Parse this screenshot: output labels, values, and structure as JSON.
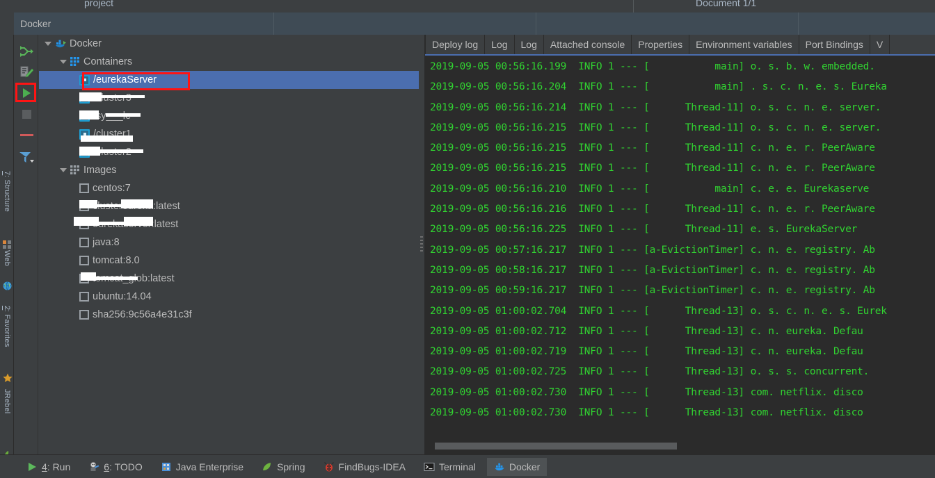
{
  "top_strip": {
    "project_tab": "project",
    "document_tab": "Document 1/1"
  },
  "tool_window": {
    "title": "Docker"
  },
  "left_vertical_bar": {
    "items": [
      {
        "num": "7",
        "label": ": Structure",
        "icon": "structure-icon"
      },
      {
        "num": "",
        "label": "Web",
        "icon": "web-globe-icon"
      },
      {
        "num": "2",
        "label": ": Favorites",
        "icon": "star-icon"
      },
      {
        "num": "",
        "label": "JRebel",
        "icon": "jrebel-icon"
      }
    ]
  },
  "docker_toolbar": {
    "buttons": [
      {
        "name": "connect-deploy-icon",
        "tooltip": "Deploy"
      },
      {
        "name": "edit-deployment-icon",
        "tooltip": "Edit Deployment"
      },
      {
        "name": "run-icon",
        "tooltip": "Run",
        "highlighted": true
      },
      {
        "name": "stop-icon",
        "tooltip": "Stop"
      },
      {
        "name": "remove-icon",
        "tooltip": "Remove"
      },
      {
        "name": "filter-icon",
        "tooltip": "Filter"
      }
    ]
  },
  "tree": {
    "root": {
      "label": "Docker",
      "icon": "docker-whale-icon",
      "expanded": true
    },
    "containers_node": {
      "label": "Containers",
      "icon": "grid-icon",
      "expanded": true
    },
    "containers": [
      {
        "label": "/eurekaServer",
        "selected": true,
        "redacted": false
      },
      {
        "label": "/cluster3",
        "selected": false,
        "redacted": true
      },
      {
        "label": "/sy___le",
        "selected": false,
        "redacted": true
      },
      {
        "label": "/cluster1",
        "selected": false,
        "redacted": true
      },
      {
        "label": "/cluster2",
        "selected": false,
        "redacted": true
      }
    ],
    "images_node": {
      "label": "Images",
      "icon": "grid-icon",
      "expanded": true
    },
    "images": [
      {
        "label": "centos:7",
        "redacted": false
      },
      {
        "label": "clustereureka:latest",
        "redacted": true
      },
      {
        "label": "eurekaserver:latest",
        "redacted": true
      },
      {
        "label": "java:8",
        "redacted": false
      },
      {
        "label": "tomcat:8.0",
        "redacted": false
      },
      {
        "label": "tomcat_glob:latest",
        "redacted": true
      },
      {
        "label": "ubuntu:14.04",
        "redacted": false
      },
      {
        "label": "sha256:9c56a4e31c3f",
        "redacted": false
      }
    ]
  },
  "log_panel": {
    "tabs": [
      {
        "label": "Deploy log",
        "active": false
      },
      {
        "label": "Log",
        "active": false
      },
      {
        "label": "Log",
        "active": false
      },
      {
        "label": "Attached console",
        "active": false
      },
      {
        "label": "Properties",
        "active": false
      },
      {
        "label": "Environment variables",
        "active": false
      },
      {
        "label": "Port Bindings",
        "active": false
      },
      {
        "label": "V",
        "active": false
      }
    ],
    "lines": [
      "2019-09-05 00:56:16.199  INFO 1 --- [           main] o. s. b. w. embedded.",
      "2019-09-05 00:56:16.204  INFO 1 --- [           main] . s. c. n. e. s. Eureka",
      "2019-09-05 00:56:16.214  INFO 1 --- [      Thread-11] o. s. c. n. e. server.",
      "2019-09-05 00:56:16.215  INFO 1 --- [      Thread-11] o. s. c. n. e. server.",
      "2019-09-05 00:56:16.215  INFO 1 --- [      Thread-11] c. n. e. r. PeerAware",
      "2019-09-05 00:56:16.215  INFO 1 --- [      Thread-11] c. n. e. r. PeerAware",
      "2019-09-05 00:56:16.210  INFO 1 --- [           main] c. e. e. Eurekaserve",
      "2019-09-05 00:56:16.216  INFO 1 --- [      Thread-11] c. n. e. r. PeerAware",
      "2019-09-05 00:56:16.225  INFO 1 --- [      Thread-11] e. s. EurekaServer",
      "2019-09-05 00:57:16.217  INFO 1 --- [a-EvictionTimer] c. n. e. registry. Ab",
      "2019-09-05 00:58:16.217  INFO 1 --- [a-EvictionTimer] c. n. e. registry. Ab",
      "2019-09-05 00:59:16.217  INFO 1 --- [a-EvictionTimer] c. n. e. registry. Ab",
      "2019-09-05 01:00:02.704  INFO 1 --- [      Thread-13] o. s. c. n. e. s. Eurek",
      "2019-09-05 01:00:02.712  INFO 1 --- [      Thread-13] c. n. eureka. Defau",
      "2019-09-05 01:00:02.719  INFO 1 --- [      Thread-13] c. n. eureka. Defau",
      "2019-09-05 01:00:02.725  INFO 1 --- [      Thread-13] o. s. s. concurrent.",
      "2019-09-05 01:00:02.730  INFO 1 --- [      Thread-13] com. netflix. disco",
      "2019-09-05 01:00:02.730  INFO 1 --- [      Thread-13] com. netflix. disco"
    ]
  },
  "statusbar": {
    "items": [
      {
        "num": "4",
        "label": ": Run",
        "icon": "run-play-icon",
        "active": false
      },
      {
        "num": "6",
        "label": ": TODO",
        "icon": "todo-icon",
        "active": false
      },
      {
        "num": "",
        "label": "Java Enterprise",
        "icon": "java-enterprise-icon",
        "active": false
      },
      {
        "num": "",
        "label": "Spring",
        "icon": "spring-leaf-icon",
        "active": false
      },
      {
        "num": "",
        "label": "FindBugs-IDEA",
        "icon": "findbugs-icon",
        "active": false
      },
      {
        "num": "",
        "label": "Terminal",
        "icon": "terminal-icon",
        "active": false
      },
      {
        "num": "",
        "label": "Docker",
        "icon": "docker-whale-icon",
        "active": true
      }
    ]
  },
  "colors": {
    "background": "#3c3f41",
    "log_background": "#2b2b2b",
    "log_text": "#31d331",
    "selection": "#4b6eaf",
    "annotation": "#ff1414",
    "header": "#3f4b55",
    "text": "#bbbbbb",
    "container_icon": "#1d9fd4"
  }
}
